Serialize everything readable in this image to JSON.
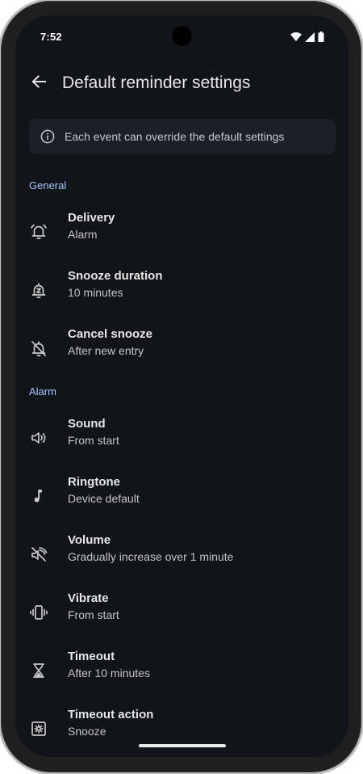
{
  "status_bar": {
    "time": "7:52",
    "icons": [
      "wifi-icon",
      "signal-icon",
      "battery-icon"
    ]
  },
  "app_bar": {
    "back_icon": "arrow-back-icon",
    "title": "Default reminder settings"
  },
  "info_banner": {
    "icon": "info-icon",
    "text": "Each event can override the default settings"
  },
  "sections": {
    "general": {
      "header": "General",
      "items": [
        {
          "icon": "alarm-bell-icon",
          "title": "Delivery",
          "subtitle": "Alarm"
        },
        {
          "icon": "snooze-icon",
          "title": "Snooze duration",
          "subtitle": "10 minutes"
        },
        {
          "icon": "bell-off-icon",
          "title": "Cancel snooze",
          "subtitle": "After new entry"
        }
      ]
    },
    "alarm": {
      "header": "Alarm",
      "items": [
        {
          "icon": "speaker-icon",
          "title": "Sound",
          "subtitle": "From start"
        },
        {
          "icon": "music-note-icon",
          "title": "Ringtone",
          "subtitle": "Device default"
        },
        {
          "icon": "volume-ramp-icon",
          "title": "Volume",
          "subtitle": "Gradually increase over 1 minute"
        },
        {
          "icon": "vibrate-icon",
          "title": "Vibrate",
          "subtitle": "From start"
        },
        {
          "icon": "hourglass-icon",
          "title": "Timeout",
          "subtitle": "After 10 minutes"
        },
        {
          "icon": "timeout-action-icon",
          "title": "Timeout action",
          "subtitle": "Snooze"
        }
      ]
    }
  },
  "colors": {
    "background": "#111418",
    "accent": "#a8c7fa",
    "banner": "#1c2026"
  }
}
